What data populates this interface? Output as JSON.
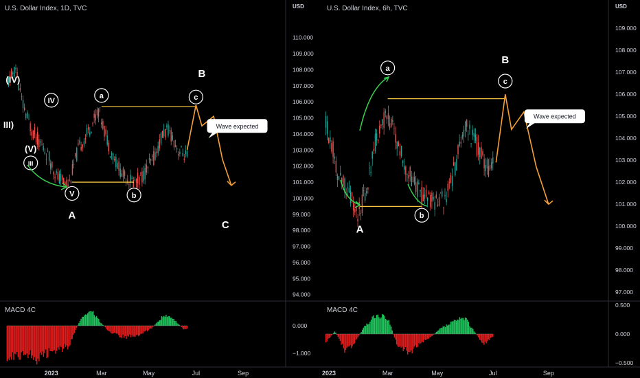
{
  "colors": {
    "background": "#000000",
    "text": "#d1d4dc",
    "grid": "#2a2e39",
    "up": "#26a69a",
    "down": "#ef5350",
    "wave_line": "#f5c542",
    "projection": "#f7a035",
    "arrow": "#39d353",
    "hist_pos": "#22c55e",
    "hist_neg": "#e11d1d"
  },
  "chart_data": [
    {
      "type": "candlestick",
      "title": "U.S. Dollar Index, 1D, TVC",
      "ylabel": "USD",
      "ylim": [
        93.6,
        111.4
      ],
      "price_ticks": [
        "110.000",
        "109.000",
        "108.000",
        "107.000",
        "106.000",
        "105.000",
        "104.000",
        "103.000",
        "102.000",
        "101.000",
        "100.000",
        "99.000",
        "98.000",
        "97.000",
        "96.000",
        "95.000",
        "94.000"
      ],
      "x_ticks": [
        "2023",
        "Mar",
        "May",
        "Jul",
        "Sep"
      ],
      "x_range": [
        -0.6,
        8.8
      ],
      "x_tick_pos": [
        1,
        2.7,
        4.3,
        5.9,
        7.5
      ],
      "price_path": [
        [
          -0.5,
          107.1
        ],
        [
          -0.2,
          108.1
        ],
        [
          0,
          106
        ],
        [
          0.3,
          104.4
        ],
        [
          0.6,
          103.5
        ],
        [
          0.9,
          102.6
        ],
        [
          1.2,
          101.3
        ],
        [
          1.6,
          100.9
        ],
        [
          1.9,
          103
        ],
        [
          2.3,
          104.3
        ],
        [
          2.6,
          105.5
        ],
        [
          3,
          103
        ],
        [
          3.4,
          101.5
        ],
        [
          3.8,
          101
        ],
        [
          4.1,
          101.4
        ],
        [
          4.5,
          102.6
        ],
        [
          4.8,
          104.1
        ],
        [
          5,
          104.2
        ],
        [
          5.3,
          103
        ],
        [
          5.6,
          102.6
        ]
      ],
      "projection": [
        [
          5.6,
          103
        ],
        [
          5.9,
          105.8
        ],
        [
          6.1,
          104.5
        ],
        [
          6.5,
          105.1
        ],
        [
          6.8,
          102.4
        ],
        [
          7.1,
          100.8
        ]
      ],
      "annotations": [
        {
          "label": "(IV)",
          "x": -0.3,
          "y": 107.4,
          "style": "plain"
        },
        {
          "label": "III)",
          "x": -0.45,
          "y": 104.6,
          "style": "plain"
        },
        {
          "label": "(V)",
          "x": 0.3,
          "y": 103.1,
          "style": "plain"
        },
        {
          "label": "IV",
          "x": 1.0,
          "y": 106.1,
          "style": "circle"
        },
        {
          "label": "III",
          "x": 0.3,
          "y": 102.2,
          "style": "circle"
        },
        {
          "label": "V",
          "x": 1.7,
          "y": 100.3,
          "style": "circle"
        },
        {
          "label": "A",
          "x": 1.7,
          "y": 99.0,
          "style": "bold"
        },
        {
          "label": "a",
          "x": 2.7,
          "y": 106.4,
          "style": "circle"
        },
        {
          "label": "b",
          "x": 3.8,
          "y": 100.2,
          "style": "circle"
        },
        {
          "label": "c",
          "x": 5.9,
          "y": 106.3,
          "style": "circle"
        },
        {
          "label": "B",
          "x": 6.1,
          "y": 107.8,
          "style": "bold"
        },
        {
          "label": "C",
          "x": 6.9,
          "y": 98.4,
          "style": "bold"
        }
      ],
      "callout": {
        "text": "Wave expected",
        "x": 7.3,
        "y": 104.5
      },
      "hlines": [
        [
          2.7,
          5.9,
          105.7
        ],
        [
          1.7,
          3.8,
          101
        ]
      ],
      "macd": {
        "label": "MACD 4C",
        "ticks": [
          "0.000",
          "−1.000"
        ],
        "tick_values": [
          0,
          -1
        ],
        "ylim": [
          -1.45,
          0.85
        ],
        "hist_path": [
          [
            -0.5,
            -1.2
          ],
          [
            0.2,
            -1.1
          ],
          [
            0.5,
            -1.3
          ],
          [
            1,
            -1.0
          ],
          [
            1.6,
            -0.8
          ],
          [
            2,
            0.3
          ],
          [
            2.4,
            0.55
          ],
          [
            2.7,
            0.1
          ],
          [
            3,
            -0.3
          ],
          [
            3.5,
            -0.45
          ],
          [
            4,
            -0.35
          ],
          [
            4.4,
            -0.1
          ],
          [
            4.8,
            0.4
          ],
          [
            5.1,
            0.3
          ],
          [
            5.5,
            -0.15
          ],
          [
            5.6,
            -0.1
          ]
        ]
      }
    },
    {
      "type": "candlestick",
      "title": "U.S. Dollar Index, 6h, TVC",
      "ylabel": "USD",
      "ylim": [
        96.6,
        109.6
      ],
      "price_ticks": [
        "109.000",
        "108.000",
        "107.000",
        "106.000",
        "105.000",
        "104.000",
        "103.000",
        "102.000",
        "101.000",
        "100.000",
        "99.000",
        "98.000",
        "97.000"
      ],
      "x_ticks": [
        "2023",
        "Mar",
        "May",
        "Jul",
        "Sep"
      ],
      "x_range": [
        -0.1,
        9.0
      ],
      "x_tick_pos": [
        0.1,
        2.0,
        3.6,
        5.4,
        7.2
      ],
      "price_path": [
        [
          0,
          104.6
        ],
        [
          0.2,
          103.8
        ],
        [
          0.4,
          102.3
        ],
        [
          0.7,
          101.8
        ],
        [
          1,
          100.4
        ],
        [
          1.3,
          101.5
        ],
        [
          1.6,
          103.8
        ],
        [
          1.9,
          105
        ],
        [
          2.2,
          104.4
        ],
        [
          2.5,
          103
        ],
        [
          2.8,
          102
        ],
        [
          3.1,
          101.4
        ],
        [
          3.5,
          101.1
        ],
        [
          3.9,
          101.3
        ],
        [
          4.2,
          102.8
        ],
        [
          4.5,
          104.7
        ],
        [
          4.8,
          103.9
        ],
        [
          5.2,
          102.6
        ],
        [
          5.4,
          102.9
        ]
      ],
      "projection": [
        [
          5.5,
          102.9
        ],
        [
          5.8,
          106
        ],
        [
          6.0,
          104.4
        ],
        [
          6.4,
          105.2
        ],
        [
          6.8,
          102.7
        ],
        [
          7.2,
          101
        ]
      ],
      "annotations": [
        {
          "label": "a",
          "x": 2.0,
          "y": 107.2,
          "style": "circle"
        },
        {
          "label": "c",
          "x": 5.8,
          "y": 106.6,
          "style": "circle"
        },
        {
          "label": "B",
          "x": 5.8,
          "y": 107.6,
          "style": "bold"
        },
        {
          "label": "A",
          "x": 1.1,
          "y": 99.9,
          "style": "bold"
        },
        {
          "label": "b",
          "x": 3.1,
          "y": 100.5,
          "style": "circle"
        }
      ],
      "callout": {
        "text": "Wave expected",
        "x": 7.4,
        "y": 105
      },
      "hlines": [
        [
          2.0,
          5.8,
          105.8
        ],
        [
          1.1,
          3.1,
          100.9
        ]
      ],
      "macd": {
        "label": "MACD 4C",
        "ticks": [
          "0.500",
          "0.000",
          "−0.500"
        ],
        "tick_values": [
          0.5,
          0,
          -0.5
        ],
        "ylim": [
          -0.55,
          0.55
        ],
        "hist_path": [
          [
            0,
            -0.15
          ],
          [
            0.3,
            0.05
          ],
          [
            0.6,
            -0.3
          ],
          [
            0.9,
            -0.2
          ],
          [
            1.2,
            0.1
          ],
          [
            1.6,
            0.35
          ],
          [
            2,
            0.3
          ],
          [
            2.3,
            -0.2
          ],
          [
            2.7,
            -0.35
          ],
          [
            3.1,
            -0.15
          ],
          [
            3.4,
            -0.05
          ],
          [
            3.7,
            0.1
          ],
          [
            4.2,
            0.25
          ],
          [
            4.5,
            0.3
          ],
          [
            4.8,
            0.05
          ],
          [
            5.1,
            -0.2
          ],
          [
            5.4,
            -0.05
          ]
        ]
      }
    }
  ]
}
